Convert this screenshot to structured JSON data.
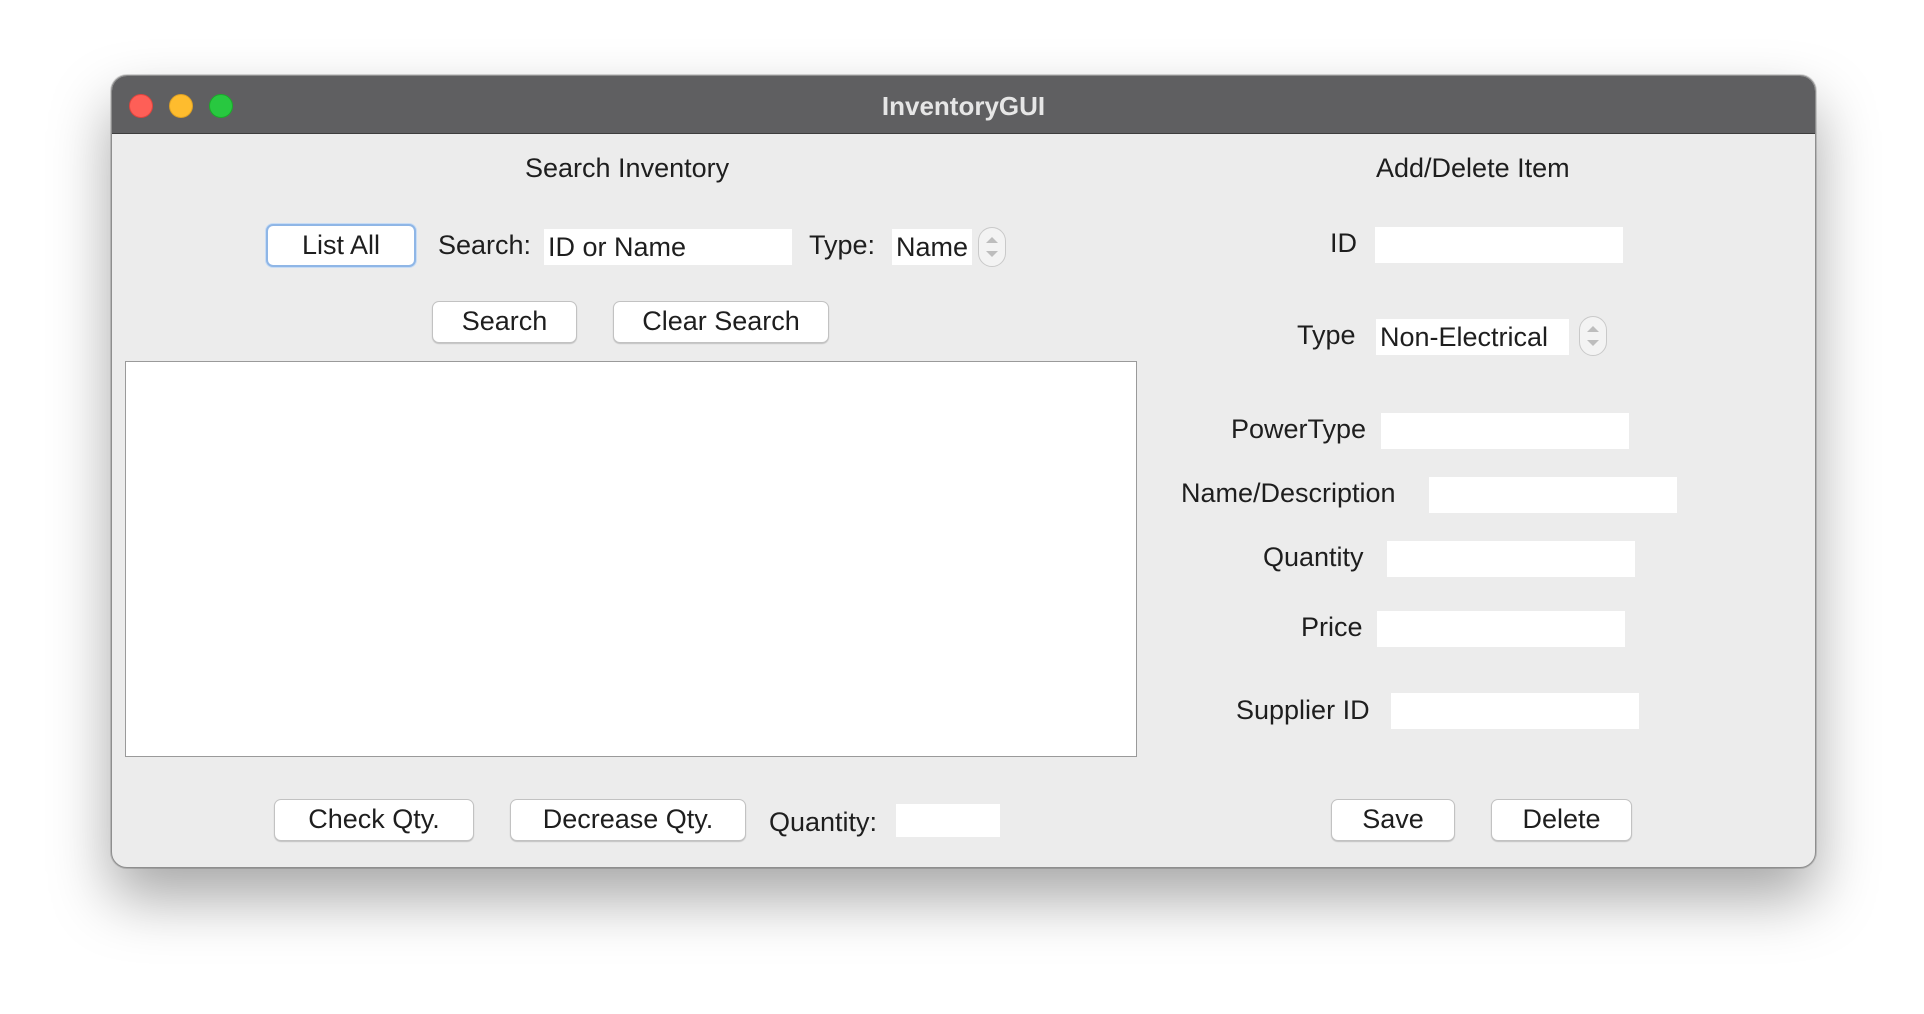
{
  "window": {
    "title": "InventoryGUI"
  },
  "search_panel": {
    "heading": "Search Inventory",
    "list_all_label": "List All",
    "search_label": "Search:",
    "search_value": "ID or Name",
    "type_label": "Type:",
    "type_value": "Name",
    "search_button": "Search",
    "clear_search_button": "Clear Search"
  },
  "quantity_panel": {
    "check_qty_button": "Check Qty.",
    "decrease_qty_button": "Decrease Qty.",
    "quantity_label": "Quantity:",
    "quantity_value": ""
  },
  "item_panel": {
    "heading": "Add/Delete Item",
    "id_label": "ID",
    "id_value": "",
    "type_label": "Type",
    "type_value": "Non-Electrical",
    "powertype_label": "PowerType",
    "powertype_value": "",
    "name_label": "Name/Description",
    "name_value": "",
    "quantity_label": "Quantity",
    "quantity_value": "",
    "price_label": "Price",
    "price_value": "",
    "supplier_label": "Supplier ID",
    "supplier_value": "",
    "save_button": "Save",
    "delete_button": "Delete"
  }
}
